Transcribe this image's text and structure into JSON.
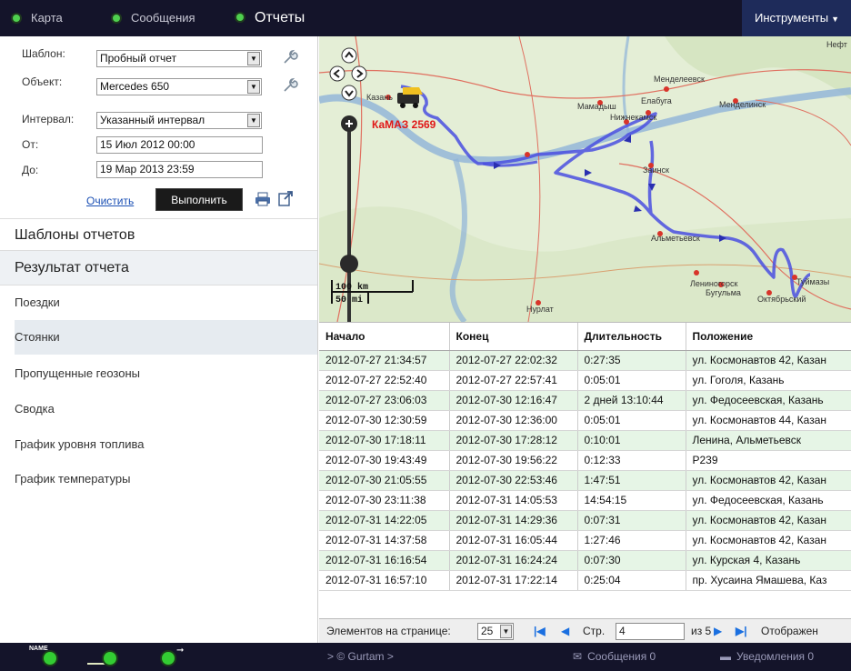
{
  "topbar": {
    "nav": [
      {
        "label": "Карта"
      },
      {
        "label": "Сообщения"
      },
      {
        "label": "Отчеты"
      }
    ],
    "tools_label": "Инструменты"
  },
  "form": {
    "template_label": "Шаблон:",
    "template_value": "Пробный отчет",
    "object_label": "Объект:",
    "object_value": "Mercedes 650",
    "interval_label": "Интервал:",
    "interval_value": "Указанный интервал",
    "from_label": "От:",
    "from_value": "15 Июл 2012 00:00",
    "to_label": "До:",
    "to_value": "19 Мар 2013 23:59",
    "clear_label": "Очистить",
    "run_label": "Выполнить"
  },
  "left": {
    "templates_header": "Шаблоны отчетов",
    "result_header": "Результат отчета",
    "items": [
      {
        "label": "Поездки"
      },
      {
        "label": "Стоянки"
      },
      {
        "label": "Пропущенные геозоны"
      },
      {
        "label": "Сводка"
      },
      {
        "label": "График уровня топлива"
      },
      {
        "label": "График температуры"
      }
    ]
  },
  "map": {
    "unit_label": "КаМАЗ 2569",
    "scale_km": "100 km",
    "scale_mi": "50 mi",
    "places": [
      "Нефт",
      "Менделеевск",
      "Мамадыш",
      "Елабуга",
      "Менделинск",
      "Нижнекамск",
      "Казань",
      "Заинск",
      "Альметьевск",
      "Лениногорск",
      "Бугульма",
      "Туймазы",
      "Октябрьский",
      "Нурлат"
    ]
  },
  "table": {
    "headers": [
      "Начало",
      "Конец",
      "Длительность",
      "Положение"
    ],
    "rows": [
      [
        "2012-07-27 21:34:57",
        "2012-07-27 22:02:32",
        "0:27:35",
        "ул. Космонавтов 42, Казан"
      ],
      [
        "2012-07-27 22:52:40",
        "2012-07-27 22:57:41",
        "0:05:01",
        "ул. Гоголя, Казань"
      ],
      [
        "2012-07-27 23:06:03",
        "2012-07-30 12:16:47",
        "2 дней 13:10:44",
        "ул. Федосеевская, Казань"
      ],
      [
        "2012-07-30 12:30:59",
        "2012-07-30 12:36:00",
        "0:05:01",
        "ул. Космонавтов 44, Казан"
      ],
      [
        "2012-07-30 17:18:11",
        "2012-07-30 17:28:12",
        "0:10:01",
        "Ленина, Альметьевск"
      ],
      [
        "2012-07-30 19:43:49",
        "2012-07-30 19:56:22",
        "0:12:33",
        "Р239"
      ],
      [
        "2012-07-30 21:05:55",
        "2012-07-30 22:53:46",
        "1:47:51",
        "ул. Космонавтов 42, Казан"
      ],
      [
        "2012-07-30 23:11:38",
        "2012-07-31 14:05:53",
        "14:54:15",
        "ул. Федосеевская, Казань"
      ],
      [
        "2012-07-31 14:22:05",
        "2012-07-31 14:29:36",
        "0:07:31",
        "ул. Космонавтов 42, Казан"
      ],
      [
        "2012-07-31 14:37:58",
        "2012-07-31 16:05:44",
        "1:27:46",
        "ул. Космонавтов 42, Казан"
      ],
      [
        "2012-07-31 16:16:54",
        "2012-07-31 16:24:24",
        "0:07:30",
        "ул. Курская 4, Казань"
      ],
      [
        "2012-07-31 16:57:10",
        "2012-07-31 17:22:14",
        "0:25:04",
        "пр. Хусаина Ямашева, Каз"
      ]
    ]
  },
  "pager": {
    "per_page_label": "Элементов на странице:",
    "per_page_value": "25",
    "page_label": "Стр.",
    "page_value": "4",
    "of_label": "из 5",
    "display_label": "Отображен"
  },
  "bottombar": {
    "name_tag": "NAME",
    "copyright": "> © Gurtam >",
    "messages": "Сообщения 0",
    "notifications": "Уведомления 0"
  },
  "colors": {
    "topbar_bg": "#14142a",
    "tools_bg": "#1e2b5a",
    "status_green": "#4fd04f",
    "row_alt": "#e6f5e6",
    "track_blue": "#4a4fe0",
    "unit_label_red": "#e01818"
  }
}
